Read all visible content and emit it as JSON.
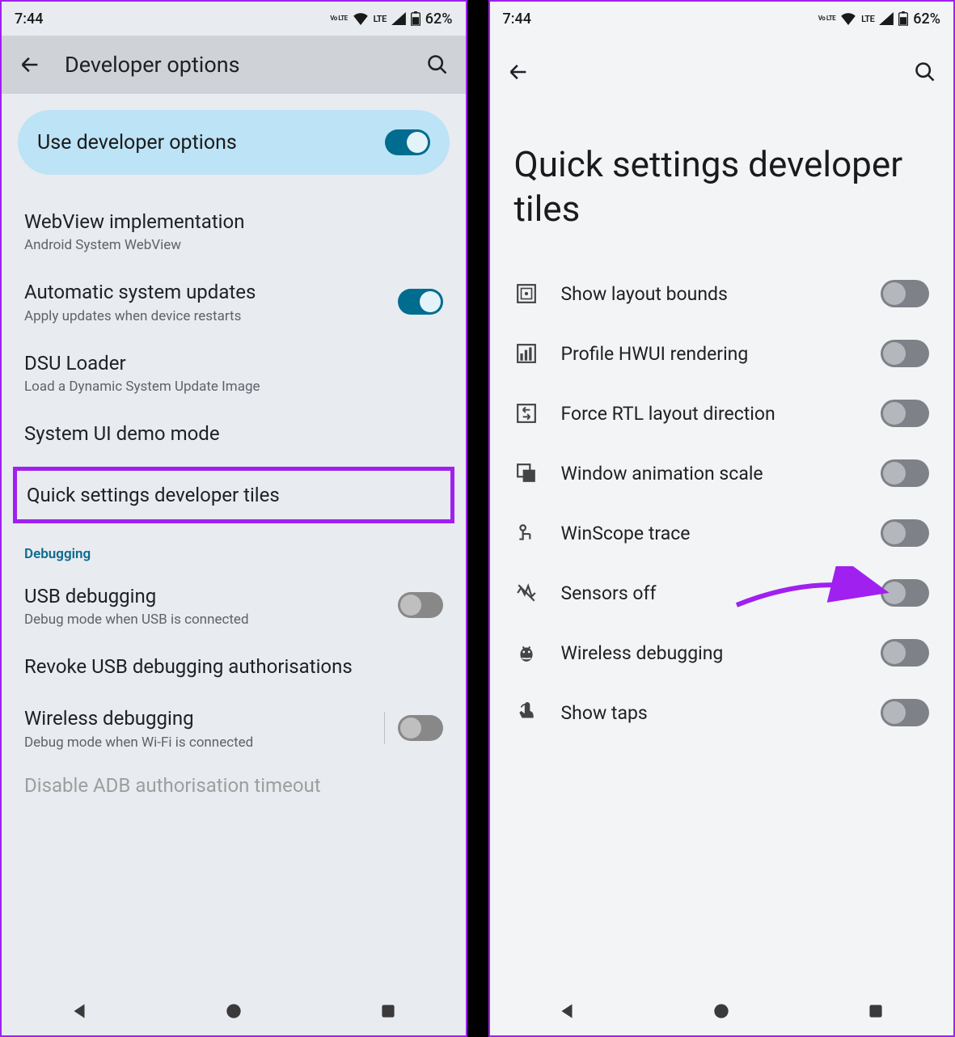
{
  "status": {
    "time": "7:44",
    "volte": "Vo LTE",
    "lte": "LTE",
    "battery": "62%"
  },
  "left": {
    "appbar_title": "Developer options",
    "master_toggle": {
      "label": "Use developer options",
      "on": true
    },
    "rows": [
      {
        "title": "WebView implementation",
        "sub": "Android System WebView"
      },
      {
        "title": "Automatic system updates",
        "sub": "Apply updates when device restarts",
        "toggle_on": true
      },
      {
        "title": "DSU Loader",
        "sub": "Load a Dynamic System Update Image"
      },
      {
        "title": "System UI demo mode"
      }
    ],
    "highlighted": "Quick settings developer tiles",
    "section": "Debugging",
    "debug_rows": [
      {
        "title": "USB debugging",
        "sub": "Debug mode when USB is connected",
        "toggle_on": false
      },
      {
        "title": "Revoke USB debugging authorisations"
      },
      {
        "title": "Wireless debugging",
        "sub": "Debug mode when Wi-Fi is connected",
        "toggle_on": false
      }
    ],
    "cutoff": "Disable ADB authorisation timeout"
  },
  "right": {
    "title": "Quick settings developer tiles",
    "tiles": [
      {
        "icon": "layout-bounds",
        "label": "Show layout bounds",
        "on": false
      },
      {
        "icon": "profile-hwui",
        "label": "Profile HWUI rendering",
        "on": false
      },
      {
        "icon": "force-rtl",
        "label": "Force RTL layout direction",
        "on": false
      },
      {
        "icon": "window-anim",
        "label": "Window animation scale",
        "on": false
      },
      {
        "icon": "winscope",
        "label": "WinScope trace",
        "on": false
      },
      {
        "icon": "sensors-off",
        "label": "Sensors off",
        "on": false,
        "arrow": true
      },
      {
        "icon": "wireless-debug",
        "label": "Wireless debugging",
        "on": false
      },
      {
        "icon": "show-taps",
        "label": "Show taps",
        "on": false
      }
    ]
  }
}
